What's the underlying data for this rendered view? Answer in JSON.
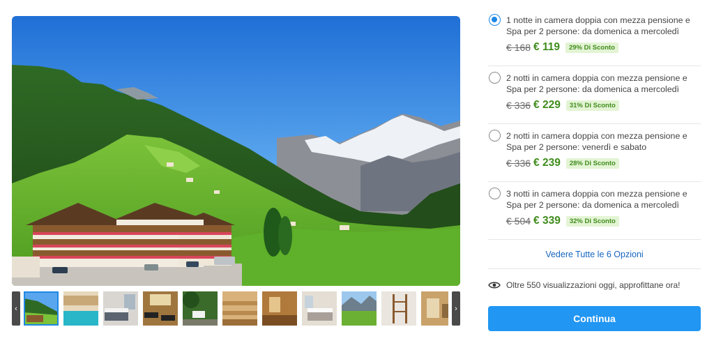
{
  "gallery": {
    "main_photo_alt": "",
    "prev_arrow": "‹",
    "next_arrow": "›",
    "thumbnails": [
      {
        "subject": "hotel-valley"
      },
      {
        "subject": "indoor-pool"
      },
      {
        "subject": "bedroom"
      },
      {
        "subject": "spa-loungers"
      },
      {
        "subject": "garden-chairs"
      },
      {
        "subject": "sauna"
      },
      {
        "subject": "wood-room"
      },
      {
        "subject": "double-bedroom"
      },
      {
        "subject": "mountain-view"
      },
      {
        "subject": "shelves"
      },
      {
        "subject": "relax-room"
      }
    ]
  },
  "options": [
    {
      "selected": true,
      "description": "1 notte in camera doppia con mezza pensione e Spa per 2 persone: da domenica a mercoledì",
      "old_price": "€ 168",
      "new_price": "€ 119",
      "discount": "29% Di Sconto"
    },
    {
      "selected": false,
      "description": "2 notti in camera doppia con mezza pensione e Spa per 2 persone: da domenica a mercoledì",
      "old_price": "€ 336",
      "new_price": "€ 229",
      "discount": "31% Di Sconto"
    },
    {
      "selected": false,
      "description": "2 notti in camera doppia con mezza pensione e Spa per 2 persone: venerdì e sabato",
      "old_price": "€ 336",
      "new_price": "€ 239",
      "discount": "28% Di Sconto"
    },
    {
      "selected": false,
      "description": "3 notti in camera doppia con mezza pensione e Spa per 2 persone: da domenica a mercoledì",
      "old_price": "€ 504",
      "new_price": "€ 339",
      "discount": "32% Di Sconto"
    }
  ],
  "all_options_link": "Vedere Tutte le 6 Opzioni",
  "views_notice": "Oltre 550 visualizzazioni oggi, approfittane ora!",
  "views_icon": "eye-icon",
  "continue_label": "Continua",
  "colors": {
    "accent": "#2196f3",
    "price_green": "#3f8c1c",
    "discount_bg": "#e3f4d4",
    "link": "#1565c0"
  }
}
